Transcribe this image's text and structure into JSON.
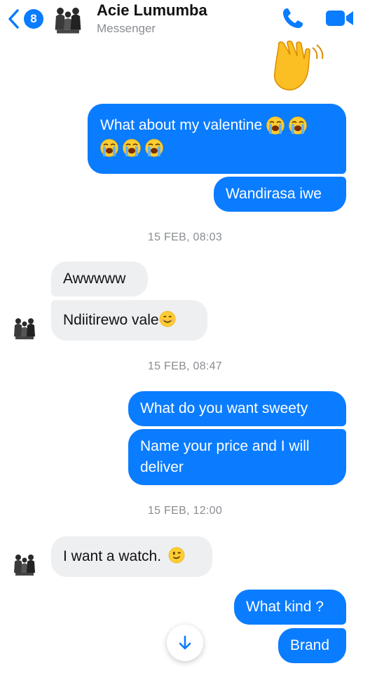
{
  "header": {
    "back_badge": "8",
    "contact_name": "Acie Lumumba",
    "subtitle": "Messenger"
  },
  "messages": {
    "m1_line1": "What about my valentine",
    "m2": "Wandirasa iwe",
    "ts1": "15 FEB, 08:03",
    "m3": "Awwwww",
    "m4": "Ndiitirewo vale",
    "ts2": "15 FEB, 08:47",
    "m5": "What do you want sweety",
    "m6_line1": "Name your price and I will",
    "m6_line2": "deliver",
    "ts3": "15 FEB, 12:00",
    "m7": "I want a watch.",
    "m8": "What kind ?",
    "m9": "Brand"
  },
  "icons": {
    "back": "chevron-left-icon",
    "call": "phone-icon",
    "video": "video-camera-icon",
    "wave": "waving-hand-emoji",
    "cry": "loudly-crying-face-emoji",
    "smile": "smiling-face-emoji",
    "wink": "winking-face-emoji",
    "scroll": "arrow-down-icon"
  },
  "colors": {
    "accent": "#0a7cff",
    "incoming_bubble": "#eeeff1",
    "timestamp": "#8a8d91"
  }
}
